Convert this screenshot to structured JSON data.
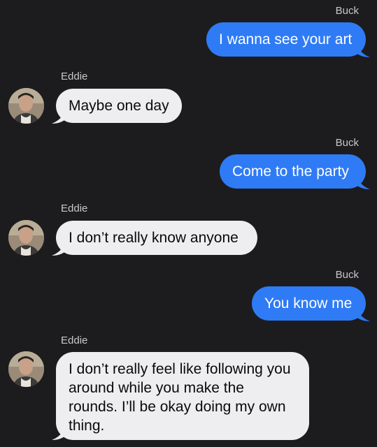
{
  "conversation": {
    "messages": [
      {
        "from": "Buck",
        "direction": "out",
        "text": "I wanna see your art"
      },
      {
        "from": "Eddie",
        "direction": "in",
        "text": "Maybe one day"
      },
      {
        "from": "Buck",
        "direction": "out",
        "text": "Come to the party"
      },
      {
        "from": "Eddie",
        "direction": "in",
        "text": "I don’t really know anyone"
      },
      {
        "from": "Buck",
        "direction": "out",
        "text": "You know me"
      },
      {
        "from": "Eddie",
        "direction": "in",
        "text": "I don’t really feel like following you around while you make the rounds. I’ll be okay doing my own thing."
      }
    ]
  },
  "colors": {
    "background": "#1c1c1e",
    "outgoing_bubble": "#2f7bf5",
    "incoming_bubble": "#eeeef1"
  }
}
